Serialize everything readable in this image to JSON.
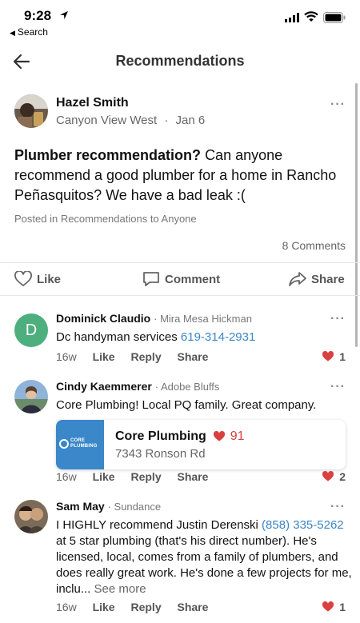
{
  "status_bar": {
    "time": "9:28",
    "back_to_app": "Search"
  },
  "nav": {
    "title": "Recommendations"
  },
  "post": {
    "author": "Hazel Smith",
    "neighborhood": "Canyon View West",
    "separator": "·",
    "date": "Jan 6",
    "subject": "Plumber recommendation?",
    "body": "Can anyone recommend a good plumber for a home in Rancho Peñasquitos? We have a bad leak :(",
    "posted_in": "Posted in Recommendations to Anyone",
    "comment_count": "8 Comments",
    "actions": {
      "like": "Like",
      "comment": "Comment",
      "share": "Share"
    }
  },
  "comments": [
    {
      "name": "Dominick Claudio",
      "hood": "· Mira Mesa Hickman",
      "avatar_letter": "D",
      "text_pre": "Dc handyman services",
      "phone": "619-314-2931",
      "age": "16w",
      "like": "Like",
      "reply": "Reply",
      "share": "Share",
      "likes": "1"
    },
    {
      "name": "Cindy Kaemmerer",
      "hood": "· Adobe Bluffs",
      "text": "Core Plumbing!  Local PQ family. Great company.",
      "business": {
        "logo_line1": "CORE",
        "logo_line2": "PLUMBING",
        "name": "Core Plumbing",
        "score": "91",
        "address": "7343 Ronson Rd"
      },
      "age": "16w",
      "like": "Like",
      "reply": "Reply",
      "share": "Share",
      "likes": "2"
    },
    {
      "name": "Sam May",
      "hood": "· Sundance",
      "text_1": "I HIGHLY recommend Justin Derenski",
      "phone": "(858) 335-5262",
      "text_2": "at 5 star plumbing (that's his direct number). He's licensed, local, comes from a family of plumbers, and does really great work. He's done a few projects for me, inclu...",
      "see_more": "See more",
      "age": "16w",
      "like": "Like",
      "reply": "Reply",
      "share": "Share",
      "likes": "1"
    }
  ],
  "colors": {
    "accent_link": "#3d86c6",
    "heart": "#d94040",
    "avatar_green": "#4caf7d",
    "brand_blue": "#3a87c9"
  }
}
